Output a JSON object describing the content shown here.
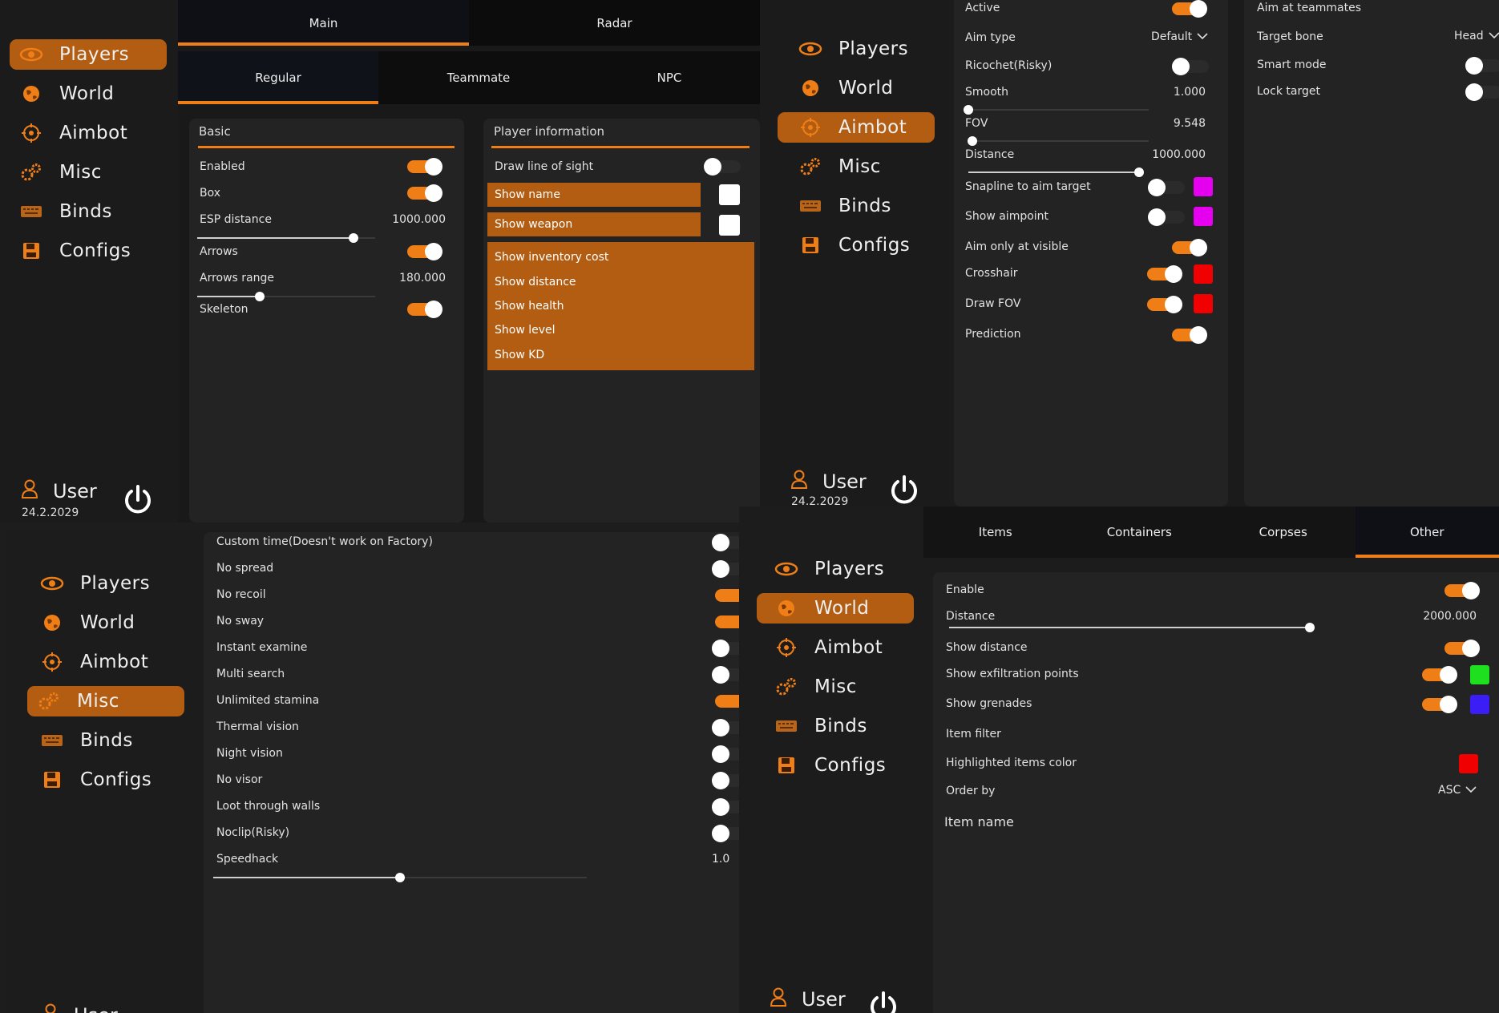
{
  "menu": {
    "players": "Players",
    "world": "World",
    "aimbot": "Aimbot",
    "misc": "Misc",
    "binds": "Binds",
    "configs": "Configs"
  },
  "user": {
    "name": "User",
    "date": "24.2.2029",
    "date_cut": "24.2.2029"
  },
  "colors": {
    "accent": "#f07e16",
    "active_bg": "#b35d12",
    "magenta": "#e600f0",
    "red": "#f00000",
    "green": "#1ee01e",
    "blue": "#3a1ef5"
  },
  "p1": {
    "tabs_top": [
      "Main",
      "Radar"
    ],
    "tabs_sub": [
      "Regular",
      "Teammate",
      "NPC"
    ],
    "basic": {
      "title": "Basic",
      "enabled": "Enabled",
      "box": "Box",
      "esp_distance": "ESP distance",
      "esp_distance_value": "1000.000",
      "esp_distance_fraction": 0.88,
      "arrows": "Arrows",
      "arrows_range": "Arrows range",
      "arrows_range_value": "180.000",
      "arrows_range_fraction": 0.35,
      "skeleton": "Skeleton"
    },
    "player_info": {
      "title": "Player information",
      "draw_los": "Draw line of sight",
      "show_name": "Show name",
      "show_weapon": "Show weapon",
      "list": [
        "Show inventory cost",
        "Show distance",
        "Show health",
        "Show level",
        "Show KD"
      ]
    }
  },
  "p2": {
    "col1": {
      "active": "Active",
      "aim_type": "Aim type",
      "aim_type_value": "Default",
      "ricochet": "Ricochet(Risky)",
      "smooth": "Smooth",
      "smooth_value": "1.000",
      "smooth_fraction": 0.0,
      "fov": "FOV",
      "fov_value": "9.548",
      "fov_fraction": 0.02,
      "distance": "Distance",
      "distance_value": "1000.000",
      "distance_fraction": 1.0,
      "snapline": "Snapline to aim target",
      "show_aimpoint": "Show aimpoint",
      "aim_visible": "Aim only at visible",
      "crosshair": "Crosshair",
      "draw_fov": "Draw FOV",
      "prediction": "Prediction"
    },
    "col2": {
      "aim_teammates": "Aim at teammates",
      "target_bone": "Target bone",
      "target_bone_value": "Head",
      "smart_mode": "Smart mode",
      "lock_target": "Lock target"
    }
  },
  "p3": {
    "rows": [
      "Custom time(Doesn't work on Factory)",
      "No spread",
      "No recoil",
      "No sway",
      "Instant examine",
      "Multi search",
      "Unlimited stamina",
      "Thermal vision",
      "Night vision",
      "No visor",
      "Loot through walls",
      "Noclip(Risky)"
    ],
    "speedhack": "Speedhack",
    "speedhack_value": "1.0",
    "speedhack_fraction": 0.5
  },
  "p4": {
    "tabs": [
      "Items",
      "Containers",
      "Corpses",
      "Other"
    ],
    "enable": "Enable",
    "distance": "Distance",
    "distance_value": "2000.000",
    "distance_fraction": 1.0,
    "show_distance": "Show distance",
    "show_exfil": "Show exfiltration points",
    "show_grenades": "Show grenades",
    "item_filter": "Item filter",
    "highlight_color": "Highlighted items color",
    "order_by": "Order by",
    "order_by_value": "ASC",
    "item_name": "Item name"
  }
}
